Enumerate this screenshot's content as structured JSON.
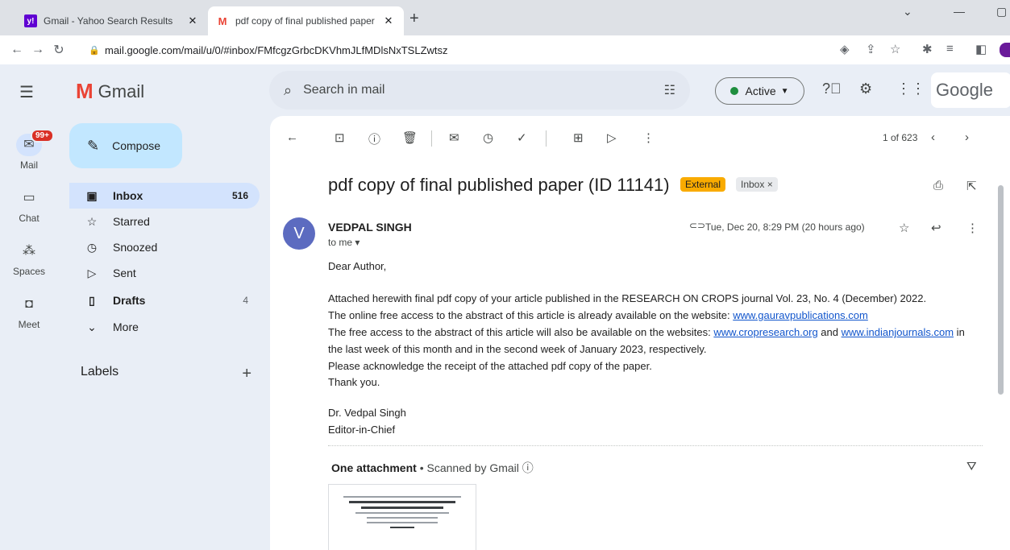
{
  "browser": {
    "tabs": [
      {
        "title": "Gmail - Yahoo Search Results",
        "favicon": "yahoo-icon"
      },
      {
        "title": "pdf copy of final published paper",
        "favicon": "gmail-icon"
      }
    ],
    "url": "mail.google.com/mail/u/0/#inbox/FMfcgzGrbcDKVhmJLfMDlsNxTSLZwtsz"
  },
  "gmail": {
    "logo_text": "Gmail",
    "search_placeholder": "Search in mail",
    "status": "Active",
    "account_label": "Google"
  },
  "rail": {
    "mail_badge": "99+",
    "items": [
      {
        "label": "Mail",
        "icon": "mail-icon"
      },
      {
        "label": "Chat",
        "icon": "chat-icon"
      },
      {
        "label": "Spaces",
        "icon": "spaces-icon"
      },
      {
        "label": "Meet",
        "icon": "meet-icon"
      }
    ]
  },
  "nav": {
    "compose": "Compose",
    "items": [
      {
        "label": "Inbox",
        "count": "516"
      },
      {
        "label": "Starred",
        "count": ""
      },
      {
        "label": "Snoozed",
        "count": ""
      },
      {
        "label": "Sent",
        "count": ""
      },
      {
        "label": "Drafts",
        "count": "4"
      },
      {
        "label": "More",
        "count": ""
      }
    ],
    "labels_header": "Labels"
  },
  "message": {
    "pager": "1 of 623",
    "subject": "pdf copy of final published paper (ID 11141)",
    "external_badge": "External",
    "inbox_badge": "Inbox ×",
    "avatar_letter": "V",
    "sender": "VEDPAL SINGH",
    "to": "to me ▾",
    "date": "Tue, Dec 20, 8:29 PM (20 hours ago)",
    "greeting": "Dear Author,",
    "line1": "Attached herewith final pdf copy of your article published in the RESEARCH ON CROPS journal Vol. 23, No. 4 (December) 2022.",
    "line2_text": "The online free access to the abstract of this article is already available on the website: ",
    "line2_link": "www.gauravpublications.com",
    "line3_text": "The free access to the abstract of this article will also be available on the websites: ",
    "line3_link1": "www.cropresearch.org",
    "line3_and": " and ",
    "line3_link2": "www.indianjournals.com",
    "line3_end": " in",
    "line4": "the last week of this month and in the second week of January 2023, respectively.",
    "line5": "Please acknowledge the receipt of the attached pdf copy of the paper.",
    "line6": "Thank you.",
    "sign1": "Dr. Vedpal Singh",
    "sign2": "Editor-in-Chief",
    "attach_title": "One attachment",
    "attach_scanned": " • Scanned by Gmail ⓘ"
  }
}
